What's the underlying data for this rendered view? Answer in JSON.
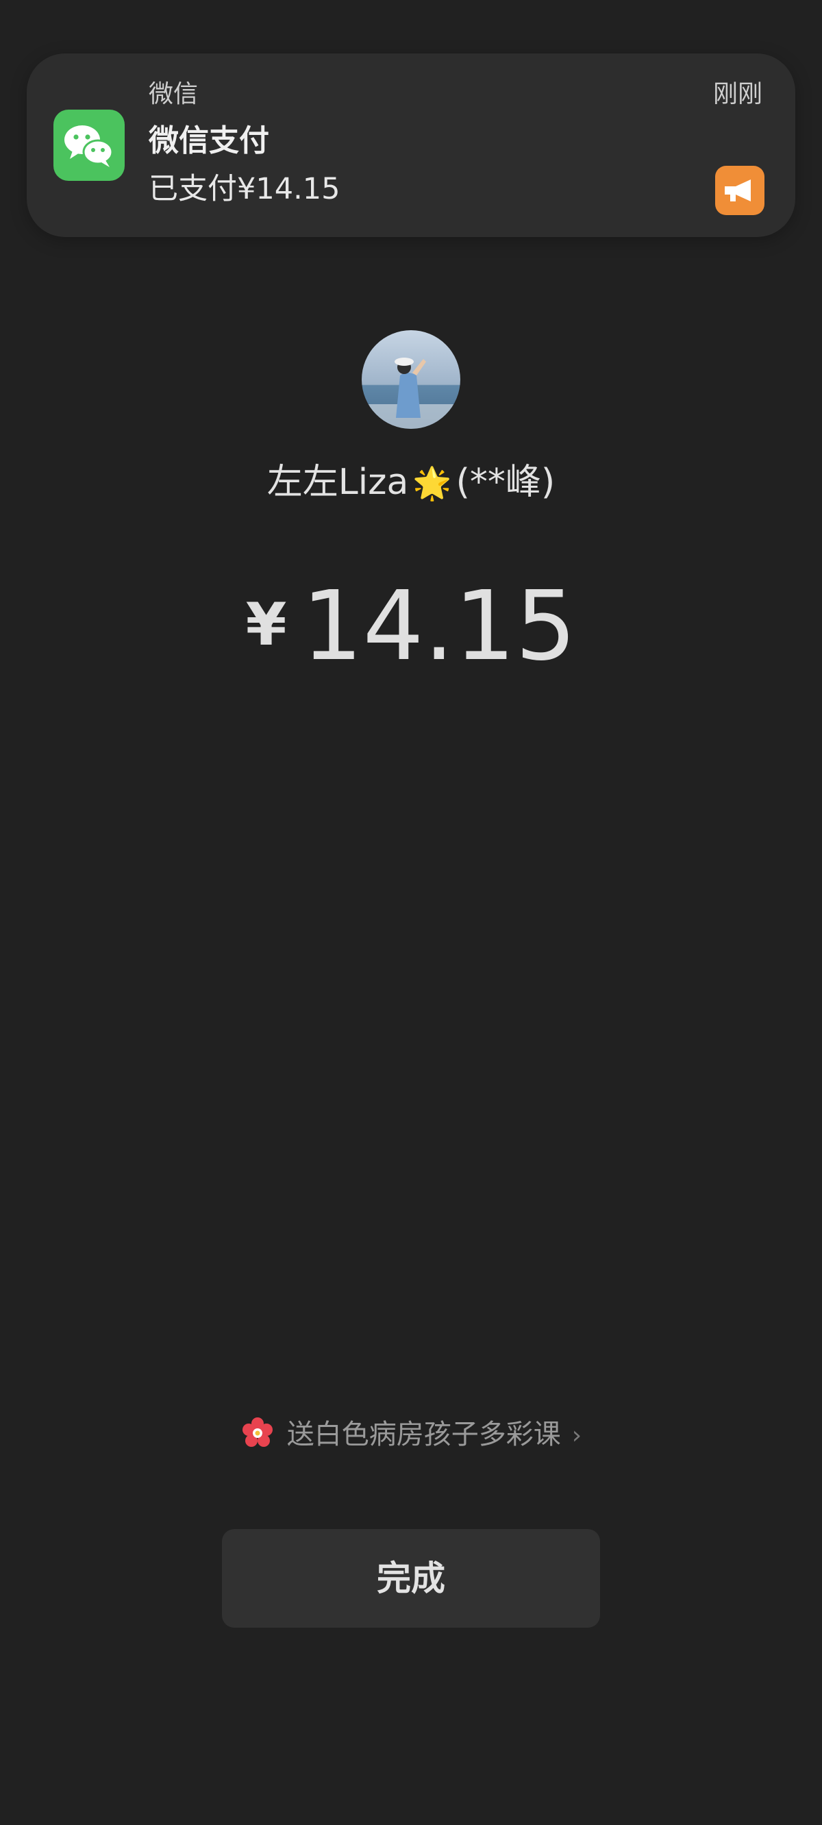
{
  "notification": {
    "app_name": "微信",
    "title": "微信支付",
    "body": "已支付¥14.15",
    "time": "刚刚",
    "app_icon": "wechat-icon",
    "action_icon": "megaphone-icon"
  },
  "payee": {
    "name": "左左Liza",
    "emoji": "🌟",
    "masked_name": "(**峰)"
  },
  "amount": {
    "currency": "¥",
    "value": "14.15"
  },
  "charity": {
    "label": "送白色病房孩子多彩课",
    "icon": "flower-icon",
    "chevron": "›"
  },
  "actions": {
    "done_label": "完成"
  },
  "colors": {
    "background": "#212121",
    "notification_bg": "#2d2d2d",
    "wechat_green": "#4bc35e",
    "action_orange": "#f08e37",
    "button_bg": "#313131"
  }
}
